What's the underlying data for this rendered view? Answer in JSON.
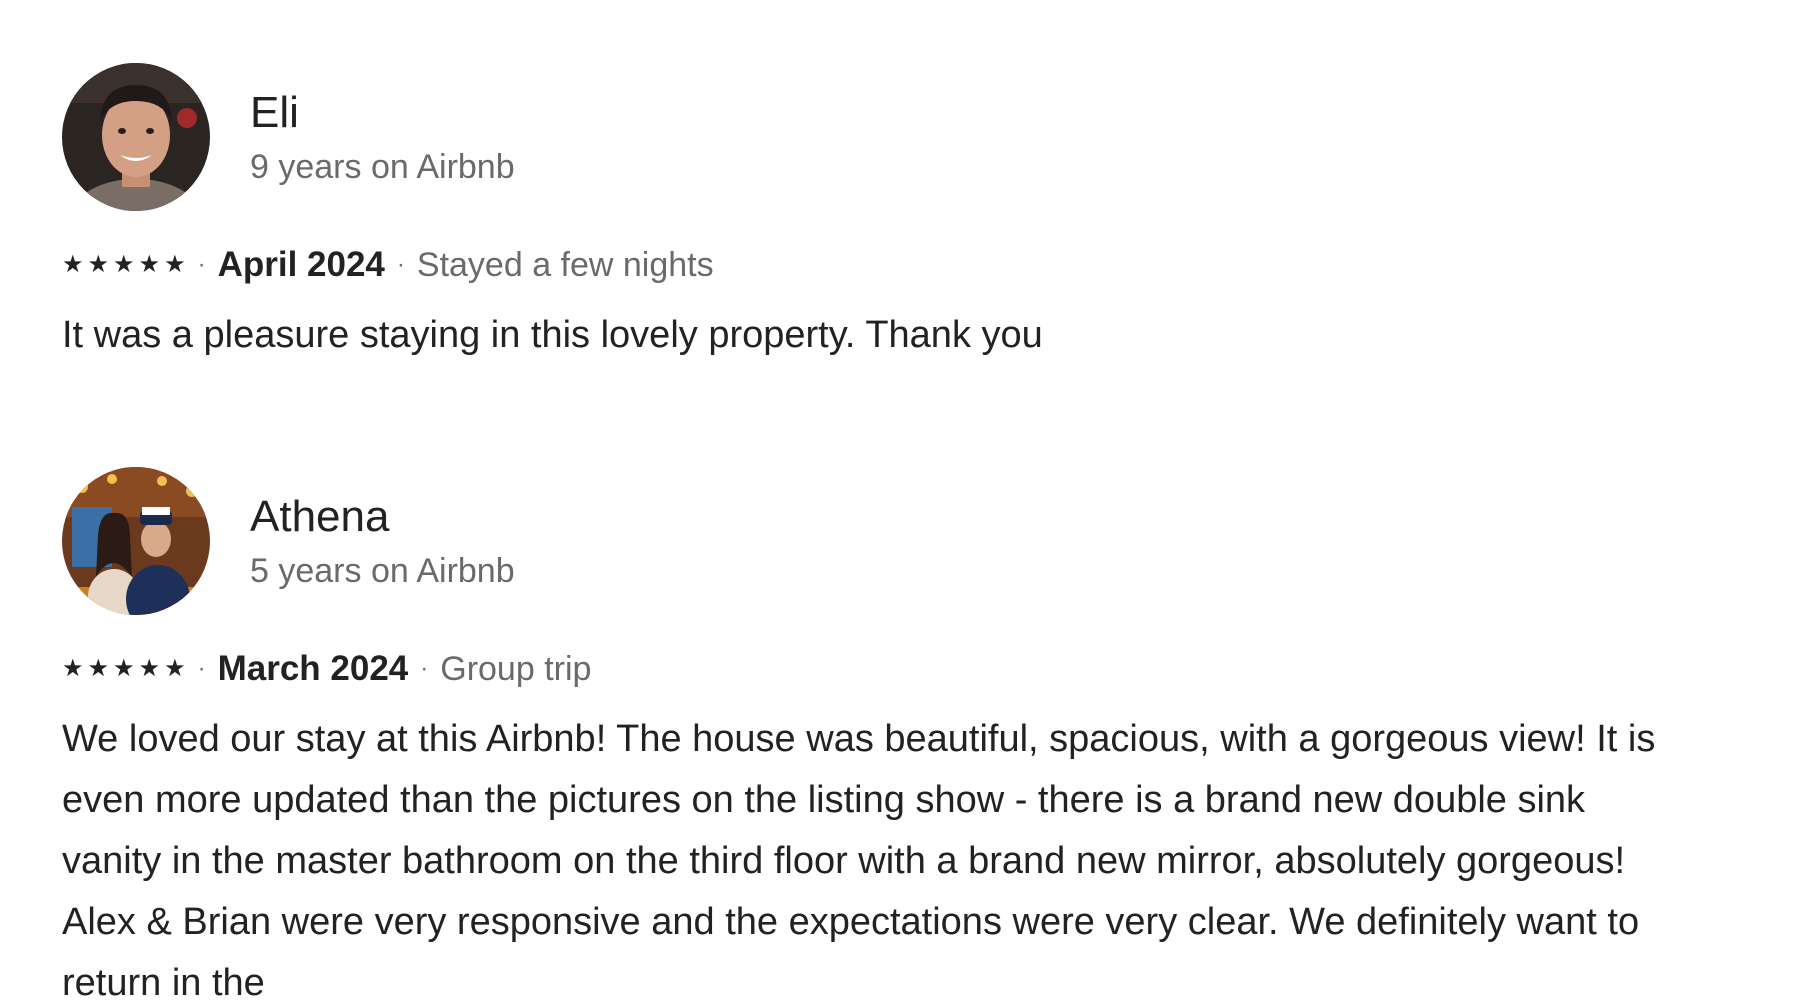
{
  "reviews": [
    {
      "name": "Eli",
      "tenure": "9 years on Airbnb",
      "rating": 5,
      "separator": "·",
      "date": "April 2024",
      "stay_type": "Stayed a few nights",
      "text": "It was a pleasure staying in this lovely property. Thank you"
    },
    {
      "name": "Athena",
      "tenure": "5 years on Airbnb",
      "rating": 5,
      "separator": "·",
      "date": "March 2024",
      "stay_type": "Group trip",
      "text": "We loved our stay at this Airbnb! The house was beautiful, spacious, with a gorgeous view! It is even more updated than the pictures on the listing show - there is a brand new double sink vanity in the master bathroom on the third floor with a brand new mirror, absolutely gorgeous! Alex & Brian were very responsive and the expectations were very clear. We definitely want to return in the"
    }
  ],
  "icons": {
    "star": "★"
  },
  "colors": {
    "text_primary": "#222222",
    "text_secondary": "#6a6a6a",
    "background": "#ffffff"
  }
}
